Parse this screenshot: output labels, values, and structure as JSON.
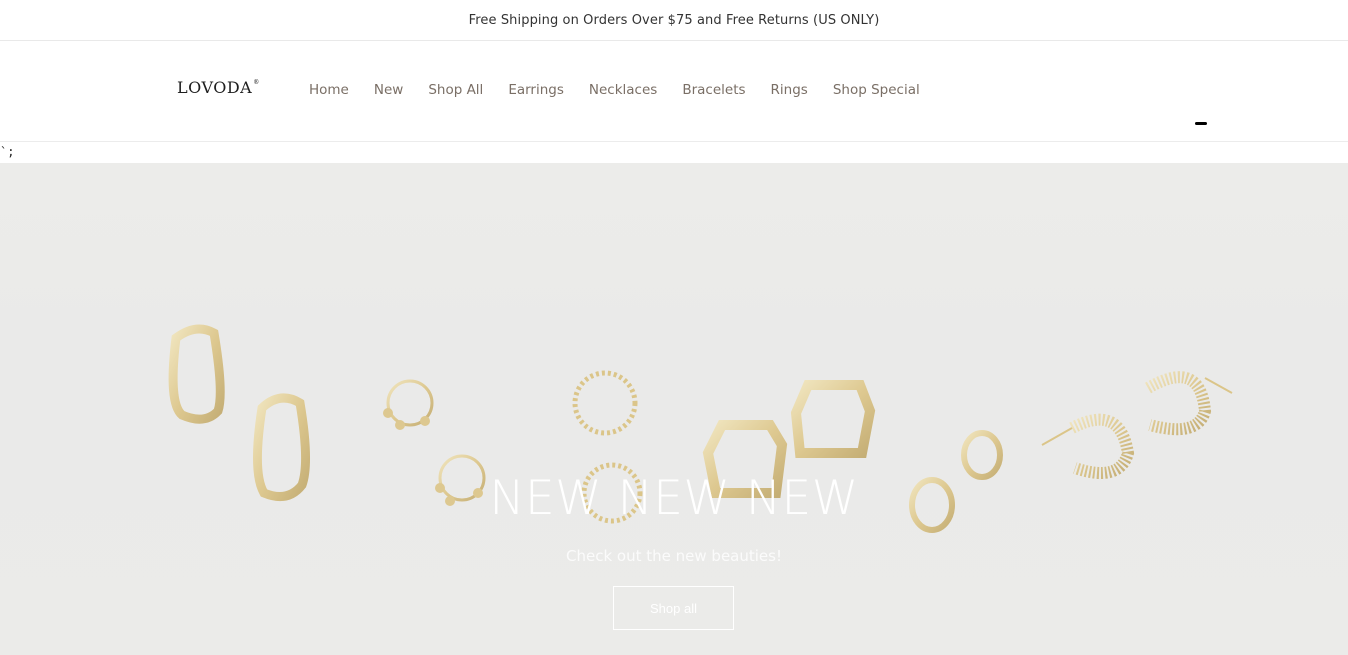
{
  "announcement": "Free Shipping on Orders Over $75 and Free Returns (US ONLY)",
  "logo": {
    "text": "LOVODA",
    "mark": "®"
  },
  "nav": {
    "items": [
      "Home",
      "New",
      "Shop All",
      "Earrings",
      "Necklaces",
      "Bracelets",
      "Rings",
      "Shop Special"
    ]
  },
  "cart_icon": "cart-icon",
  "stray_text": "`;",
  "hero": {
    "title": "NEW NEW NEW",
    "subtitle": "Check out the new beauties!",
    "button_label": "Shop all",
    "colors": {
      "background": "#ebebe9",
      "gold": "#d9bd72"
    }
  }
}
